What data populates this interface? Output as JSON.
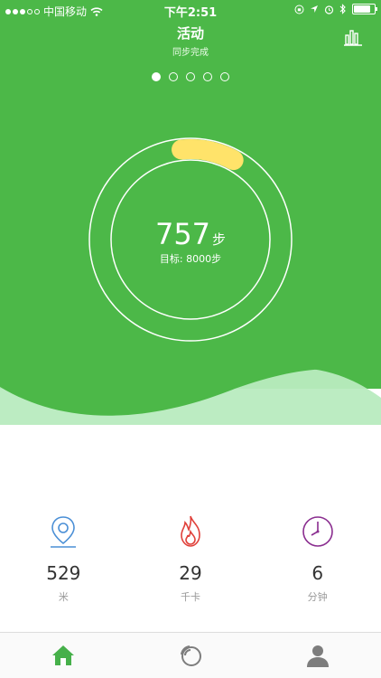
{
  "status_bar": {
    "carrier": "中国移动",
    "time": "下午2:51",
    "signal_filled": 3,
    "signal_total": 5,
    "battery_level": 0.9
  },
  "header": {
    "title": "活动",
    "subtitle": "同步完成",
    "right_icon": "bar-chart-icon"
  },
  "pager": {
    "count": 5,
    "active_index": 0
  },
  "ring": {
    "steps_value": "757",
    "steps_unit": "步",
    "goal_text": "目标: 8000步",
    "progress": 0.095
  },
  "stats": [
    {
      "icon": "location-pin-icon",
      "value": "529",
      "label": "米",
      "color": "#4a8fd6"
    },
    {
      "icon": "flame-icon",
      "value": "29",
      "label": "千卡",
      "color": "#e0403a"
    },
    {
      "icon": "clock-icon",
      "value": "6",
      "label": "分钟",
      "color": "#8a2d8f"
    }
  ],
  "tabs": [
    {
      "icon": "home-icon",
      "active": true
    },
    {
      "icon": "activity-rings-icon",
      "active": false
    },
    {
      "icon": "profile-icon",
      "active": false
    }
  ],
  "colors": {
    "green": "#4cb848",
    "light_green": "#b8ebbf",
    "progress_yellow": "#ffe36a",
    "tab_active": "#46b04a",
    "tab_inactive": "#7d7d7d"
  }
}
